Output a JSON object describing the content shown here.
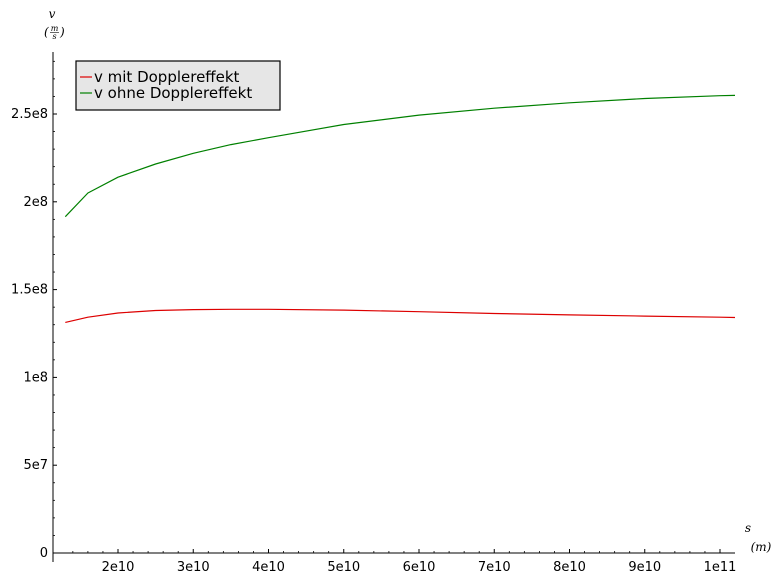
{
  "chart_data": {
    "type": "line",
    "xlabel": "s",
    "xunit": "(m)",
    "ylabel": "v",
    "yunit_num": "m",
    "yunit_den": "s",
    "xlim": [
      12500000000.0,
      102000000000.0
    ],
    "ylim": [
      0,
      285000000.0
    ],
    "x_ticks": [
      {
        "value": 20000000000.0,
        "label": "2e10"
      },
      {
        "value": 30000000000.0,
        "label": "3e10"
      },
      {
        "value": 40000000000.0,
        "label": "4e10"
      },
      {
        "value": 50000000000.0,
        "label": "5e10"
      },
      {
        "value": 60000000000.0,
        "label": "6e10"
      },
      {
        "value": 70000000000.0,
        "label": "7e10"
      },
      {
        "value": 80000000000.0,
        "label": "8e10"
      },
      {
        "value": 90000000000.0,
        "label": "9e10"
      },
      {
        "value": 100000000000.0,
        "label": "1e11"
      }
    ],
    "y_ticks": [
      {
        "value": 0,
        "label": "0"
      },
      {
        "value": 50000000.0,
        "label": "5e7"
      },
      {
        "value": 100000000.0,
        "label": "1e8"
      },
      {
        "value": 150000000.0,
        "label": "1.5e8"
      },
      {
        "value": 200000000.0,
        "label": "2e8"
      },
      {
        "value": 250000000.0,
        "label": "2.5e8"
      }
    ],
    "legend_position": "top-left",
    "grid": false,
    "series": [
      {
        "name": "v mit Dopplereffekt",
        "color": "#dd0000",
        "x": [
          13000000000.0,
          16000000000.0,
          20000000000.0,
          25000000000.0,
          30000000000.0,
          35000000000.0,
          40000000000.0,
          50000000000.0,
          60000000000.0,
          70000000000.0,
          80000000000.0,
          90000000000.0,
          100000000000.0,
          102000000000.0
        ],
        "y": [
          131300000.0,
          134300000.0,
          136700000.0,
          138100000.0,
          138600000.0,
          138800000.0,
          138800000.0,
          138300000.0,
          137400000.0,
          136400000.0,
          135600000.0,
          134900000.0,
          134300000.0,
          134100000.0
        ]
      },
      {
        "name": "v ohne Dopplereffekt",
        "color": "#008000",
        "x": [
          13000000000.0,
          16000000000.0,
          20000000000.0,
          25000000000.0,
          30000000000.0,
          35000000000.0,
          40000000000.0,
          50000000000.0,
          60000000000.0,
          70000000000.0,
          80000000000.0,
          90000000000.0,
          100000000000.0,
          102000000000.0
        ],
        "y": [
          191500000.0,
          205000000.0,
          214000000.0,
          221500000.0,
          227600000.0,
          232600000.0,
          236500000.0,
          244000000.0,
          249400000.0,
          253300000.0,
          256400000.0,
          258800000.0,
          260400000.0,
          260600000.0
        ]
      }
    ]
  }
}
